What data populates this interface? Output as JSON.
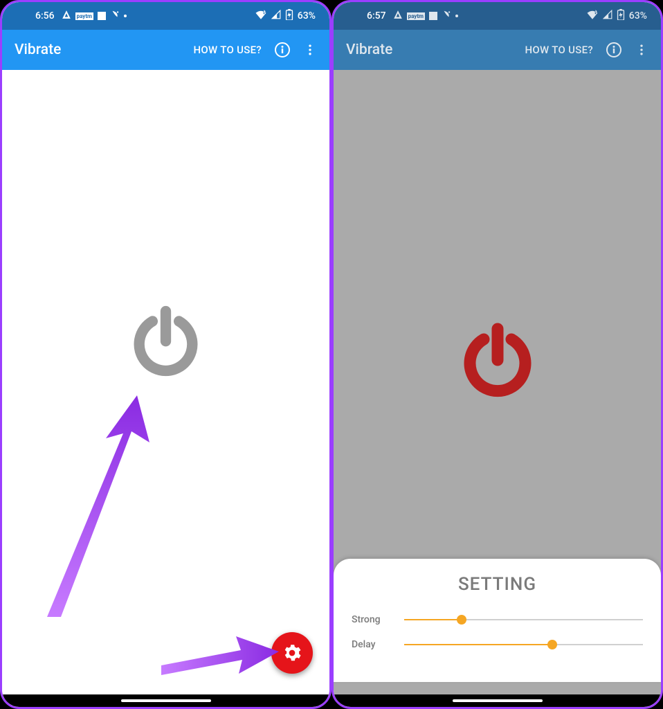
{
  "left": {
    "status": {
      "time": "6:56",
      "battery": "63%"
    },
    "appbar": {
      "title": "Vibrate",
      "how_to_use": "HOW TO USE?"
    },
    "power_color": "#9a9a9a",
    "fab_visible": true
  },
  "right": {
    "status": {
      "time": "6:57",
      "battery": "63%"
    },
    "appbar": {
      "title": "Vibrate",
      "how_to_use": "HOW TO USE?"
    },
    "power_color": "#b61f1f",
    "sheet": {
      "title": "SETTING",
      "sliders": [
        {
          "label": "Strong",
          "value": 24
        },
        {
          "label": "Delay",
          "value": 62
        }
      ]
    }
  },
  "colors": {
    "accent": "#f5a623",
    "fab": "#e5141a",
    "arrow": "#9b3eff"
  }
}
